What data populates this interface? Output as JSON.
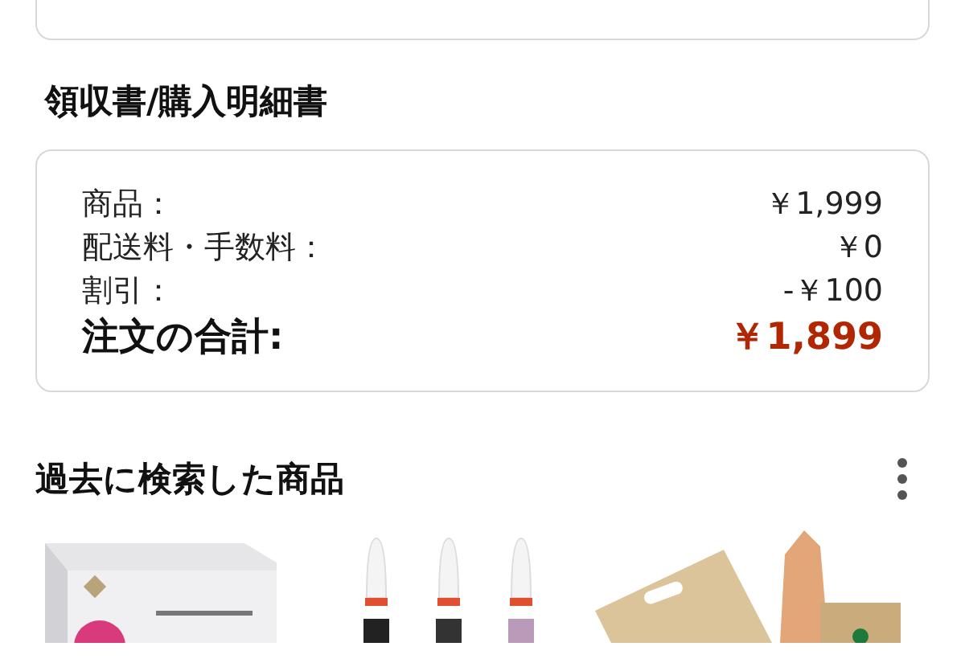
{
  "receipt": {
    "title": "領収書/購入明細書",
    "rows": [
      {
        "kind": "line",
        "label": "商品：",
        "value": "￥1,999"
      },
      {
        "kind": "line",
        "label": "配送料・手数料：",
        "value": "￥0"
      },
      {
        "kind": "line",
        "label": "割引：",
        "value": "-￥100"
      },
      {
        "kind": "total",
        "label": "注文の合計:",
        "value": "￥1,899"
      }
    ]
  },
  "history": {
    "title": "過去に検索した商品"
  }
}
